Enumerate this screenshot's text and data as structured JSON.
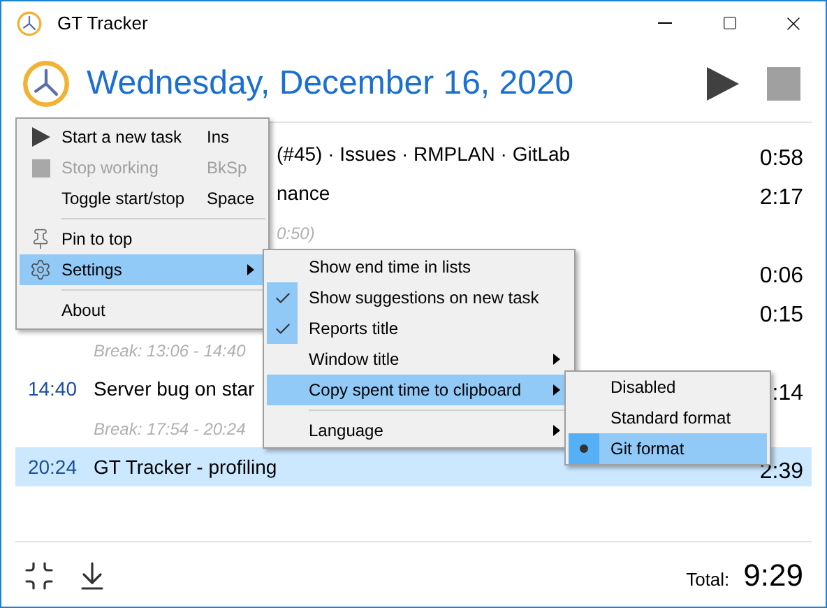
{
  "window": {
    "title": "GT Tracker"
  },
  "header": {
    "date": "Wednesday, December 16, 2020"
  },
  "tasks": [
    {
      "kind": "fragment",
      "title": "(#45) · Issues · RMPLAN · GitLab",
      "duration": "0:58",
      "selected": false
    },
    {
      "kind": "fragment",
      "title": "nance",
      "duration": "2:17",
      "selected": false
    },
    {
      "kind": "break_fragment",
      "title": "0:50)",
      "selected": false
    },
    {
      "kind": "task",
      "duration": "0:06",
      "selected": false
    },
    {
      "kind": "task",
      "duration": "0:15",
      "selected": false
    },
    {
      "kind": "break",
      "title": "Break:  13:06 - 14:40",
      "selected": false
    },
    {
      "kind": "task",
      "start": "14:40",
      "title": "Server bug on star",
      "duration": ":14",
      "selected": false
    },
    {
      "kind": "break",
      "title": "Break:  17:54 - 20:24",
      "selected": false
    },
    {
      "kind": "task",
      "start": "20:24",
      "title": "GT Tracker - profiling",
      "duration": "2:39",
      "selected": true
    }
  ],
  "footer": {
    "total_label": "Total:",
    "total": "9:29"
  },
  "main_menu": [
    {
      "kind": "item",
      "label": "Start a new task",
      "shortcut": "Ins",
      "disabled": false,
      "selected": false,
      "submenu": false
    },
    {
      "kind": "item",
      "label": "Stop working",
      "shortcut": "BkSp",
      "disabled": true,
      "selected": false,
      "submenu": false
    },
    {
      "kind": "item",
      "label": "Toggle start/stop",
      "shortcut": "Space",
      "disabled": false,
      "selected": false,
      "submenu": false
    },
    {
      "kind": "separator"
    },
    {
      "kind": "item",
      "label": "Pin to top",
      "disabled": false,
      "selected": false,
      "submenu": false
    },
    {
      "kind": "item",
      "label": "Settings",
      "disabled": false,
      "selected": true,
      "submenu": true
    },
    {
      "kind": "separator"
    },
    {
      "kind": "item",
      "label": "About",
      "disabled": false,
      "selected": false,
      "submenu": false
    }
  ],
  "settings_menu": [
    {
      "kind": "item",
      "label": "Show end time in lists",
      "checked": false,
      "selected": false,
      "submenu": false
    },
    {
      "kind": "item",
      "label": "Show suggestions on new task",
      "checked": true,
      "selected": false,
      "submenu": false
    },
    {
      "kind": "item",
      "label": "Reports title",
      "checked": true,
      "selected": false,
      "submenu": false
    },
    {
      "kind": "item",
      "label": "Window title",
      "checked": false,
      "selected": false,
      "submenu": true
    },
    {
      "kind": "item",
      "label": "Copy spent time to clipboard",
      "checked": false,
      "selected": true,
      "submenu": true
    },
    {
      "kind": "separator"
    },
    {
      "kind": "item",
      "label": "Language",
      "checked": false,
      "selected": false,
      "submenu": true
    }
  ],
  "clipboard_menu": [
    {
      "label": "Disabled",
      "selected": false
    },
    {
      "label": "Standard format",
      "selected": false
    },
    {
      "label": "Git format",
      "selected": true
    }
  ]
}
